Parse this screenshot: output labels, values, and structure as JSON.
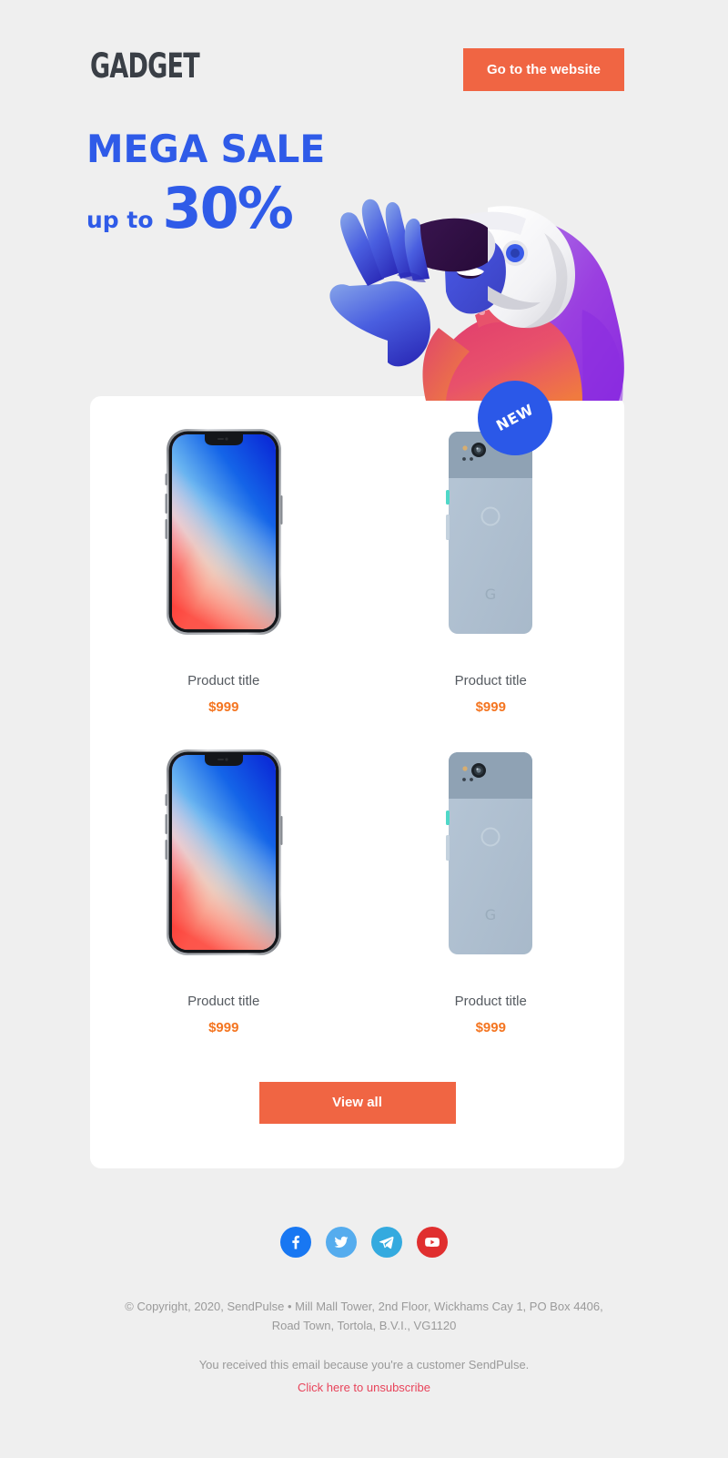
{
  "theme": {
    "background": "#efefef",
    "card_background": "#ffffff",
    "accent_orange": "#F06543",
    "price_orange": "#F47521",
    "accent_blue": "#2F5BE8",
    "badge_blue": "#2B58E8",
    "unsubscribe_red": "#E8435A",
    "muted_text": "#9a9a9a",
    "title_text": "#555a60"
  },
  "header": {
    "logo_text": "GADGET",
    "cta_label": "Go to the website"
  },
  "hero": {
    "headline": "MEGA SALE",
    "upto_label": "up to",
    "discount": "30%",
    "illustration_name": "vr-headset-person-illustration"
  },
  "products": {
    "rows": [
      {
        "items": [
          {
            "image_name": "iphone-x-product-image",
            "title": "Product title",
            "price": "$999",
            "badge": null
          },
          {
            "image_name": "pixel-phone-product-image",
            "title": "Product title",
            "price": "$999",
            "badge": "NEW"
          }
        ]
      },
      {
        "items": [
          {
            "image_name": "iphone-x-product-image",
            "title": "Product title",
            "price": "$999",
            "badge": null
          },
          {
            "image_name": "pixel-phone-product-image",
            "title": "Product title",
            "price": "$999",
            "badge": null
          }
        ]
      }
    ],
    "view_all_label": "View all"
  },
  "social": {
    "items": [
      {
        "name": "facebook-icon",
        "color": "#1877F2"
      },
      {
        "name": "twitter-icon",
        "color": "#55ACEE"
      },
      {
        "name": "telegram-icon",
        "color": "#34AADF"
      },
      {
        "name": "youtube-icon",
        "color": "#E02F2F"
      }
    ]
  },
  "footer": {
    "copyright": "© Copyright, 2020, SendPulse • Mill Mall Tower, 2nd Floor, Wickhams Cay 1, PO Box 4406, Road Town, Tortola, B.V.I., VG1120",
    "note": "You received this email because you're a customer SendPulse.",
    "unsubscribe": "Click here to unsubscribe"
  }
}
